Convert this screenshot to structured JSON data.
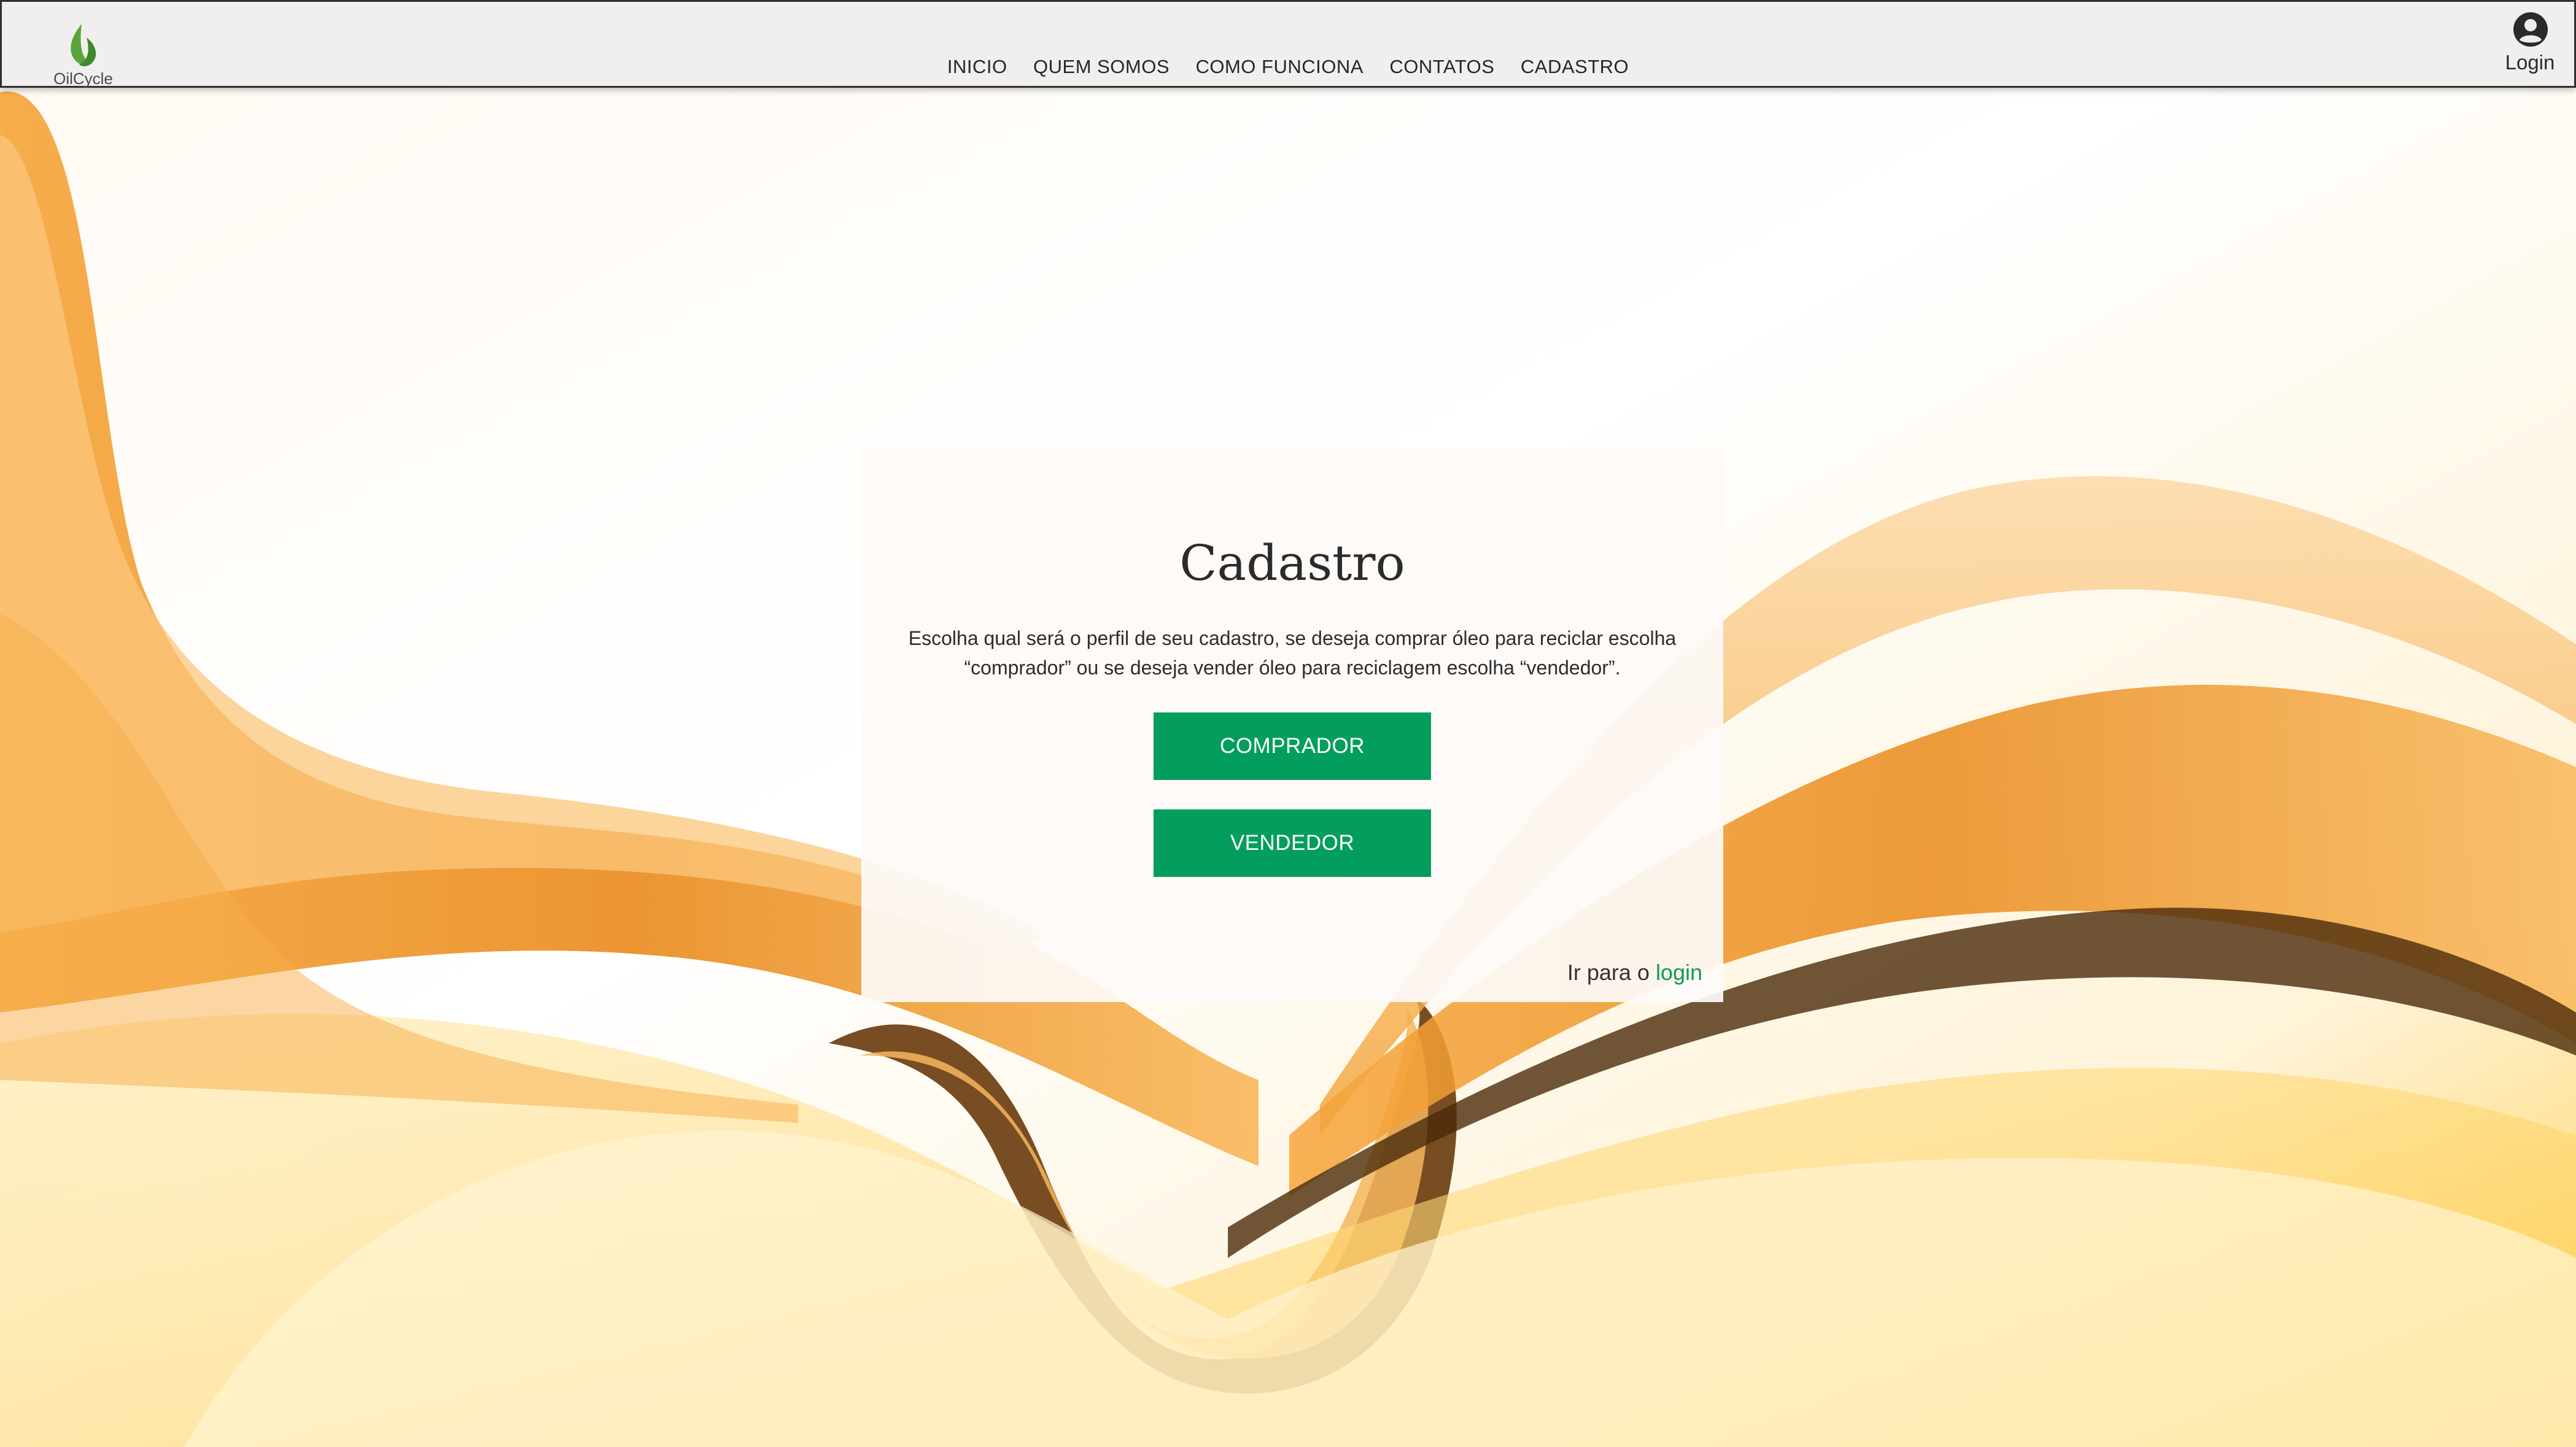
{
  "header": {
    "logo_text": "OilCycle",
    "nav": [
      "INICIO",
      "QUEM SOMOS",
      "COMO FUNCIONA",
      "CONTATOS",
      "CADASTRO"
    ],
    "login_label": "Login"
  },
  "card": {
    "title": "Cadastro",
    "description": "Escolha qual será o perfil de seu cadastro, se deseja comprar óleo para reciclar escolha “comprador” ou se deseja vender óleo para reciclagem escolha “vendedor”.",
    "buttons": {
      "comprador": "COMPRADOR",
      "vendedor": "VENDEDOR"
    },
    "goto_login_prefix": "Ir para o",
    "goto_login_link": "login"
  },
  "colors": {
    "accent_green": "#039e5e",
    "header_bg": "#f1eeee",
    "wave_orange": "#f4a531"
  },
  "icons": [
    "leaf-icon",
    "user-circle-icon"
  ]
}
